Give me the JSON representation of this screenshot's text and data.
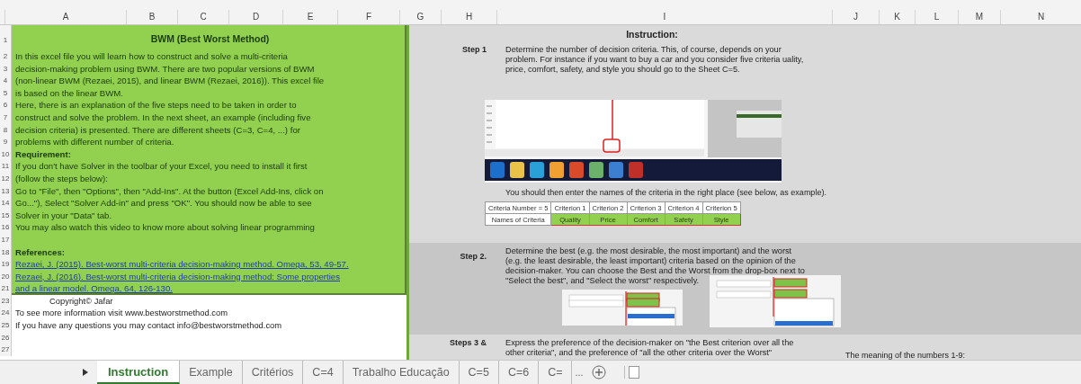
{
  "columns": [
    "A",
    "B",
    "C",
    "D",
    "E",
    "F",
    "G",
    "H",
    "I",
    "J",
    "K",
    "L",
    "M",
    "N"
  ],
  "left_panel": {
    "title_row": "1",
    "title": "BWM (Best Worst Method)",
    "rows": [
      {
        "row": "2",
        "kind": "text",
        "text": "In this excel file you will learn how to construct and solve a multi-criteria"
      },
      {
        "row": "3",
        "kind": "text",
        "text": "decision-making problem using BWM. There are two popular versions of BWM"
      },
      {
        "row": "4",
        "kind": "text",
        "text": "(non-linear BWM (Rezaei, 2015), and linear BWM (Rezaei, 2016)). This excel file"
      },
      {
        "row": "5",
        "kind": "text",
        "text": "is based on the linear BWM."
      },
      {
        "row": "6",
        "kind": "text",
        "text": "Here, there is an explanation of the five steps need to be taken in order to"
      },
      {
        "row": "7",
        "kind": "text",
        "text": "construct and solve the problem. In the next sheet, an example (including five"
      },
      {
        "row": "8",
        "kind": "text",
        "text": "decision criteria) is presented. There are different sheets (C=3, C=4, ...) for"
      },
      {
        "row": "9",
        "kind": "text",
        "text": "problems with different number of criteria."
      },
      {
        "row": "10",
        "kind": "heading",
        "text": "Requirement:"
      },
      {
        "row": "11",
        "kind": "text",
        "text": "If you don't have Solver in the toolbar of your Excel, you need to install it first"
      },
      {
        "row": "12",
        "kind": "text",
        "text": "(follow the steps below):"
      },
      {
        "row": "13",
        "kind": "text",
        "text": "Go to \"File\", then \"Options\", then \"Add-Ins\". At the button (Excel Add-Ins, click on"
      },
      {
        "row": "14",
        "kind": "text",
        "text": "Go...\"), Select \"Solver Add-in\" and press \"OK\". You should now be able to see"
      },
      {
        "row": "15",
        "kind": "text",
        "text": "Solver in your \"Data\" tab."
      },
      {
        "row": "16",
        "kind": "text",
        "text": "You may also watch this video to know more about solving linear programming"
      },
      {
        "row": "17",
        "kind": "blank"
      },
      {
        "row": "18",
        "kind": "heading",
        "text": "References:"
      },
      {
        "row": "19",
        "kind": "link",
        "text": "Rezaei, J. (2015). Best-worst multi-criteria decision-making method. Omega, 53, 49-57."
      },
      {
        "row": "20",
        "kind": "link",
        "text": "Rezaei, J. (2016). Best-worst multi-criteria decision-making method: Some properties"
      },
      {
        "row": "21",
        "kind": "link",
        "text": "and a linear model. Omega, 64, 126-130."
      }
    ]
  },
  "below_rows": [
    {
      "row": "23",
      "kind": "indent",
      "text": "Copyright© Jafar"
    },
    {
      "row": "24",
      "kind": "text",
      "text": "To see more information visit www.bestworstmethod.com"
    },
    {
      "row": "25",
      "kind": "text",
      "text": "If you have any questions you may contact info@bestworstmethod.com"
    },
    {
      "row": "26",
      "kind": "blank"
    },
    {
      "row": "27",
      "kind": "blank"
    }
  ],
  "instruction": {
    "title": "Instruction:",
    "step1": {
      "label": "Step 1",
      "text": "Determine the number of decision criteria. This, of course, depends on your problem. For instance if you want to buy a car and you consider five criteria uality, price, comfort, safety, and style you should go to the Sheet C=5.",
      "note": "You should then enter the names of the criteria in the right place (see below, as example).",
      "table": {
        "header": [
          "Criteria Number = 5",
          "Criterion 1",
          "Criterion 2",
          "Criterion 3",
          "Criterion 4",
          "Criterion 5"
        ],
        "label": "Names of Criteria",
        "names": [
          "Quality",
          "Price",
          "Comfort",
          "Safety",
          "Style"
        ]
      }
    },
    "step2": {
      "label": "Step 2.",
      "text": "Determine the best (e.g. the most desirable, the most important) and the worst (e.g. the least desirable, the least important) criteria based on the opinion of the decision-maker. You can choose the Best and the Worst from the drop-box next to \"Select the best\", and \"Select the worst\" respectively."
    },
    "step3": {
      "label": "Steps 3 &",
      "text": "Express the preference of the decision-maker on \"the Best criterion over all the other criteria\", and the preference of \"all the other criteria over the Worst\"",
      "side_note": "The meaning of the numbers 1-9:"
    }
  },
  "sheet_tabs": [
    {
      "label": "Instruction",
      "selected": true
    },
    {
      "label": "Example",
      "selected": false
    },
    {
      "label": "Critérios",
      "selected": false
    },
    {
      "label": "C=4",
      "selected": false
    },
    {
      "label": "Trabalho Educação",
      "selected": false
    },
    {
      "label": "C=5",
      "selected": false
    },
    {
      "label": "C=6",
      "selected": false
    },
    {
      "label": "C=",
      "selected": false
    }
  ],
  "more_tabs": "..."
}
